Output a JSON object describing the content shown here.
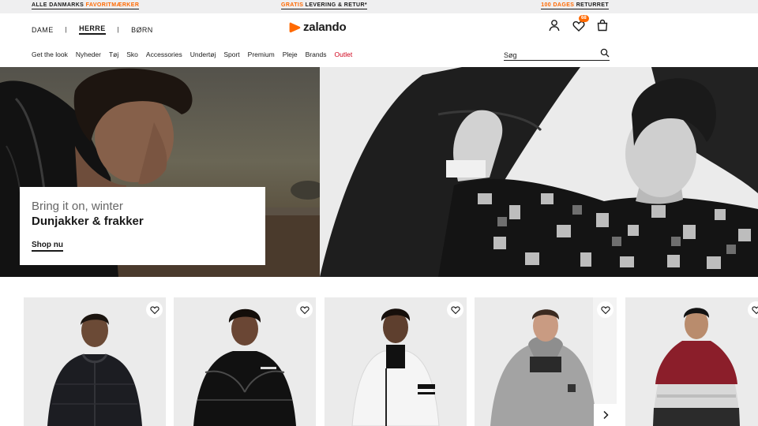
{
  "promo": {
    "left_prefix": "ALLE DANMARKS ",
    "left_highlight": "FAVORITMÆRKER",
    "center_highlight": "GRATIS",
    "center_rest": " LEVERING & RETUR*",
    "right_highlight": "100 DAGES",
    "right_rest": " RETURRET"
  },
  "header": {
    "gender_nav": [
      "DAME",
      "HERRE",
      "BØRN"
    ],
    "active_gender": "HERRE",
    "logo_text": "zalando",
    "wishlist_count": "68",
    "icons": [
      "user-icon",
      "heart-icon",
      "bag-icon"
    ]
  },
  "categories": [
    "Get the look",
    "Nyheder",
    "Tøj",
    "Sko",
    "Accessories",
    "Undertøj",
    "Sport",
    "Premium",
    "Pleje",
    "Brands",
    "Outlet"
  ],
  "search": {
    "placeholder": "Søg"
  },
  "hero": {
    "subtitle": "Bring it on, winter",
    "title": "Dunjakker & frakker",
    "cta": "Shop nu"
  },
  "products": [
    {
      "jacket_color": "#1c1d22",
      "skin": "#6b4a36",
      "hair": "#1b140f"
    },
    {
      "jacket_color": "#111111",
      "skin": "#6a4634",
      "hair": "#140e0a"
    },
    {
      "jacket_color": "#f5f5f5",
      "skin": "#5e3f2e",
      "hair": "#160f0b"
    },
    {
      "jacket_color": "#a3a3a3",
      "skin": "#c99b82",
      "hair": "#3b2a20"
    },
    {
      "jacket_color": "#8b1e2a",
      "skin": "#b98c6d",
      "hair": "#121212"
    }
  ],
  "colors": {
    "accent": "#ff6900",
    "outlet": "#d0021b",
    "text": "#1a1a1a"
  }
}
